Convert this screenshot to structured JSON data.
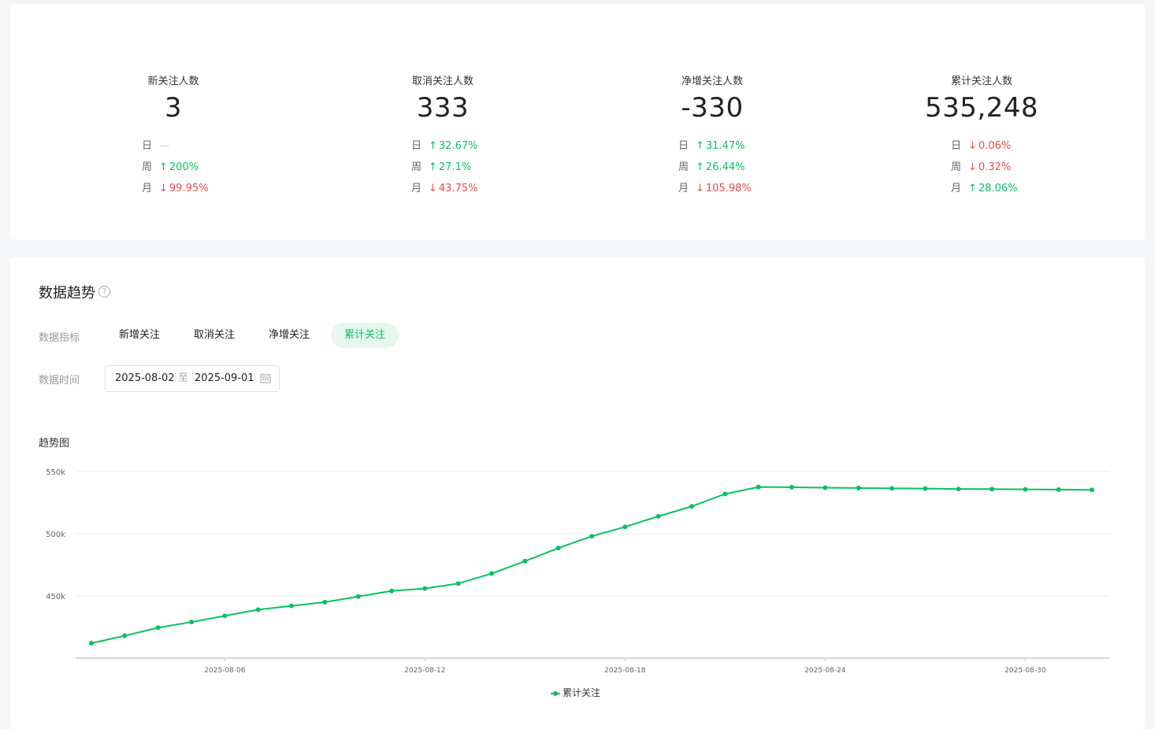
{
  "stats": [
    {
      "label": "新关注人数",
      "value": "3",
      "comparisons": [
        {
          "period": "日",
          "arrow": "",
          "value": "—",
          "dir": "none"
        },
        {
          "period": "周",
          "arrow": "↑",
          "value": "200%",
          "dir": "up"
        },
        {
          "period": "月",
          "arrow": "↓",
          "value": "99.95%",
          "dir": "down"
        }
      ]
    },
    {
      "label": "取消关注人数",
      "value": "333",
      "comparisons": [
        {
          "period": "日",
          "arrow": "↑",
          "value": "32.67%",
          "dir": "up"
        },
        {
          "period": "周",
          "arrow": "↑",
          "value": "27.1%",
          "dir": "up"
        },
        {
          "period": "月",
          "arrow": "↓",
          "value": "43.75%",
          "dir": "down"
        }
      ]
    },
    {
      "label": "净增关注人数",
      "value": "-330",
      "comparisons": [
        {
          "period": "日",
          "arrow": "↑",
          "value": "31.47%",
          "dir": "up"
        },
        {
          "period": "周",
          "arrow": "↑",
          "value": "26.44%",
          "dir": "up"
        },
        {
          "period": "月",
          "arrow": "↓",
          "value": "105.98%",
          "dir": "down"
        }
      ]
    },
    {
      "label": "累计关注人数",
      "value": "535,248",
      "comparisons": [
        {
          "period": "日",
          "arrow": "↓",
          "value": "0.06%",
          "dir": "down"
        },
        {
          "period": "周",
          "arrow": "↓",
          "value": "0.32%",
          "dir": "down"
        },
        {
          "period": "月",
          "arrow": "↑",
          "value": "28.06%",
          "dir": "up"
        }
      ]
    }
  ],
  "trend": {
    "title": "数据趋势",
    "help_icon": "question-circle-icon",
    "metric_label": "数据指标",
    "metrics": [
      "新增关注",
      "取消关注",
      "净增关注",
      "累计关注"
    ],
    "active_metric": "累计关注",
    "time_label": "数据时间",
    "date_start": "2025-08-02",
    "date_sep": "至",
    "date_end": "2025-09-01",
    "calendar_icon": "calendar-icon",
    "chart_title": "趋势图"
  },
  "colors": {
    "accent": "#07c160",
    "down": "#e84a4a"
  },
  "chart_data": {
    "type": "line",
    "y_ticks": [
      "450k",
      "500k",
      "550k"
    ],
    "y_tick_values": [
      450000,
      500000,
      550000
    ],
    "ylim": [
      400000,
      550000
    ],
    "x_ticks": [
      "2025-08-06",
      "2025-08-12",
      "2025-08-18",
      "2025-08-24",
      "2025-08-30"
    ],
    "x": [
      "2025-08-02",
      "2025-08-03",
      "2025-08-04",
      "2025-08-05",
      "2025-08-06",
      "2025-08-07",
      "2025-08-08",
      "2025-08-09",
      "2025-08-10",
      "2025-08-11",
      "2025-08-12",
      "2025-08-13",
      "2025-08-14",
      "2025-08-15",
      "2025-08-16",
      "2025-08-17",
      "2025-08-18",
      "2025-08-19",
      "2025-08-20",
      "2025-08-21",
      "2025-08-22",
      "2025-08-23",
      "2025-08-24",
      "2025-08-25",
      "2025-08-26",
      "2025-08-27",
      "2025-08-28",
      "2025-08-29",
      "2025-08-30",
      "2025-08-31",
      "2025-09-01"
    ],
    "series": [
      {
        "name": "累计关注",
        "values": [
          412000,
          418000,
          424500,
          429000,
          434000,
          439000,
          442000,
          445000,
          449500,
          454000,
          456000,
          460000,
          468000,
          478000,
          488500,
          498000,
          505500,
          514000,
          522000,
          532000,
          537600,
          537400,
          537000,
          536800,
          536500,
          536300,
          536000,
          535900,
          535700,
          535500,
          535248
        ]
      }
    ],
    "legend": [
      "累计关注"
    ],
    "legend_position": "bottom",
    "grid": true
  }
}
